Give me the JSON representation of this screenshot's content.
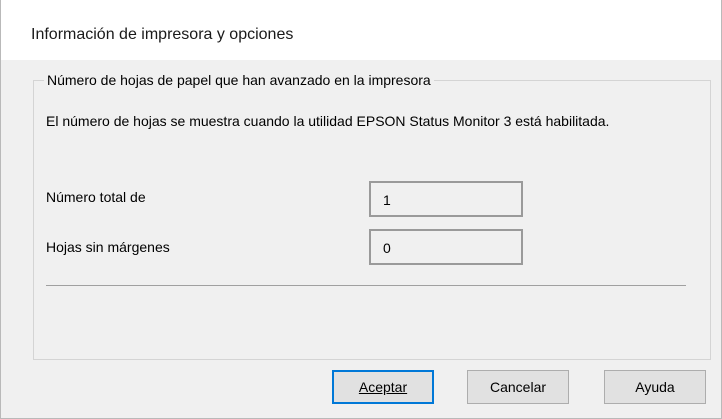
{
  "dialog": {
    "title": "Información de impresora y opciones"
  },
  "group": {
    "legend": "Número de hojas de papel que han avanzado en la impresora",
    "description": "El número de hojas se muestra cuando la utilidad EPSON Status Monitor 3 está habilitada.",
    "rows": [
      {
        "label": "Número total de",
        "value": "1"
      },
      {
        "label": "Hojas sin márgenes",
        "value": "0"
      }
    ]
  },
  "buttons": {
    "ok": "Aceptar",
    "cancel": "Cancelar",
    "help": "Ayuda"
  }
}
